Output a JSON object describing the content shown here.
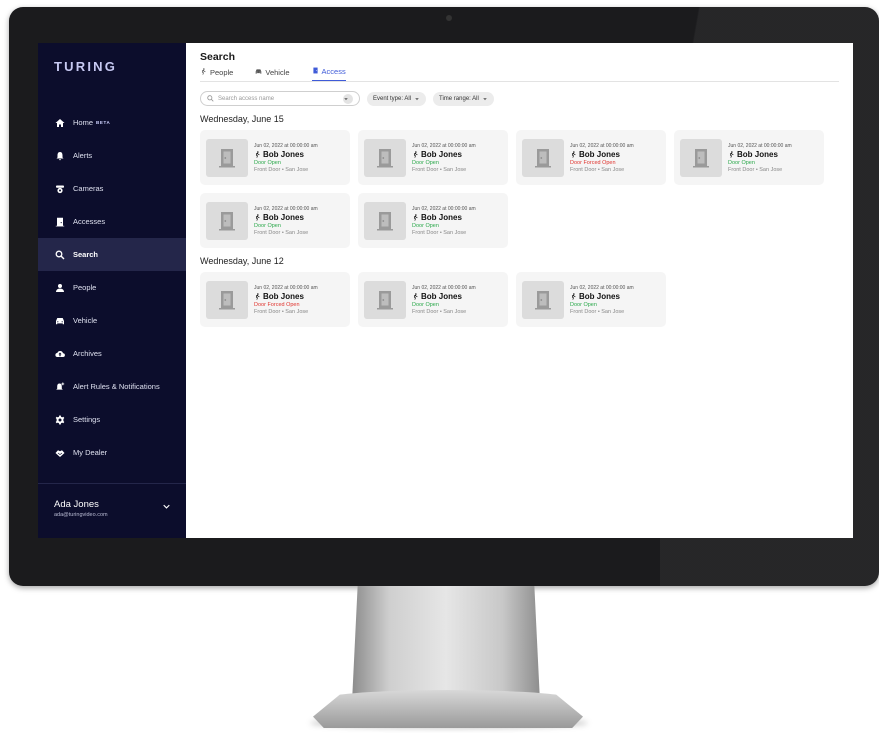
{
  "app": {
    "logo": "TURING"
  },
  "sidebar": {
    "items": [
      {
        "label": "Home",
        "badge": "BETA",
        "icon": "home-icon",
        "active": false
      },
      {
        "label": "Alerts",
        "icon": "bell-icon",
        "active": false
      },
      {
        "label": "Cameras",
        "icon": "camera-icon",
        "active": false
      },
      {
        "label": "Accesses",
        "icon": "door-icon",
        "active": false
      },
      {
        "label": "Search",
        "icon": "search-icon",
        "active": true
      },
      {
        "label": "People",
        "icon": "person-icon",
        "active": false
      },
      {
        "label": "Vehicle",
        "icon": "car-icon",
        "active": false
      },
      {
        "label": "Archives",
        "icon": "cloud-upload-icon",
        "active": false
      },
      {
        "label": "Alert Rules & Notifications",
        "icon": "bell-plus-icon",
        "active": false
      },
      {
        "label": "Settings",
        "icon": "gear-icon",
        "active": false
      },
      {
        "label": "My Dealer",
        "icon": "handshake-icon",
        "active": false
      }
    ],
    "user": {
      "name": "Ada Jones",
      "email": "ada@turingvideo.com"
    }
  },
  "main": {
    "title": "Search",
    "tabs": [
      {
        "label": "People",
        "icon": "person-walking-icon",
        "active": false
      },
      {
        "label": "Vehicle",
        "icon": "car-icon",
        "active": false
      },
      {
        "label": "Access",
        "icon": "door-icon",
        "active": true
      }
    ],
    "search": {
      "placeholder": "Search access name"
    },
    "filters": {
      "event_type": "Event type: All",
      "time_range": "Time range: All"
    },
    "groups": [
      {
        "date": "Wednesday, June 15",
        "cards": [
          {
            "timestamp": "Jun 02, 2022 at 00:00:00 am",
            "person": "Bob Jones",
            "status": "Door Open",
            "status_color": "#2aa84a",
            "location": "Front Door • San Jose"
          },
          {
            "timestamp": "Jun 02, 2022 at 00:00:00 am",
            "person": "Bob Jones",
            "status": "Door Open",
            "status_color": "#2aa84a",
            "location": "Front Door • San Jose"
          },
          {
            "timestamp": "Jun 02, 2022 at 00:00:00 am",
            "person": "Bob Jones",
            "status": "Door Forced Open",
            "status_color": "#e0342e",
            "location": "Front Door • San Jose"
          },
          {
            "timestamp": "Jun 02, 2022 at 00:00:00 am",
            "person": "Bob Jones",
            "status": "Door Open",
            "status_color": "#2aa84a",
            "location": "Front Door • San Jose"
          },
          {
            "timestamp": "Jun 02, 2022 at 00:00:00 am",
            "person": "Bob Jones",
            "status": "Door Open",
            "status_color": "#2aa84a",
            "location": "Front Door • San Jose"
          },
          {
            "timestamp": "Jun 02, 2022 at 00:00:00 am",
            "person": "Bob Jones",
            "status": "Door Open",
            "status_color": "#2aa84a",
            "location": "Front Door • San Jose"
          }
        ]
      },
      {
        "date": "Wednesday, June 12",
        "cards": [
          {
            "timestamp": "Jun 02, 2022 at 00:00:00 am",
            "person": "Bob Jones",
            "status": "Door Forced Open",
            "status_color": "#e0342e",
            "location": "Front Door • San Jose"
          },
          {
            "timestamp": "Jun 02, 2022 at 00:00:00 am",
            "person": "Bob Jones",
            "status": "Door Open",
            "status_color": "#2aa84a",
            "location": "Front Door • San Jose"
          },
          {
            "timestamp": "Jun 02, 2022 at 00:00:00 am",
            "person": "Bob Jones",
            "status": "Door Open",
            "status_color": "#2aa84a",
            "location": "Front Door • San Jose"
          }
        ]
      }
    ]
  },
  "colors": {
    "sidebar_bg": "#0c0d2c",
    "accent": "#3f5bd8",
    "status_open": "#2aa84a",
    "status_forced": "#e0342e"
  }
}
